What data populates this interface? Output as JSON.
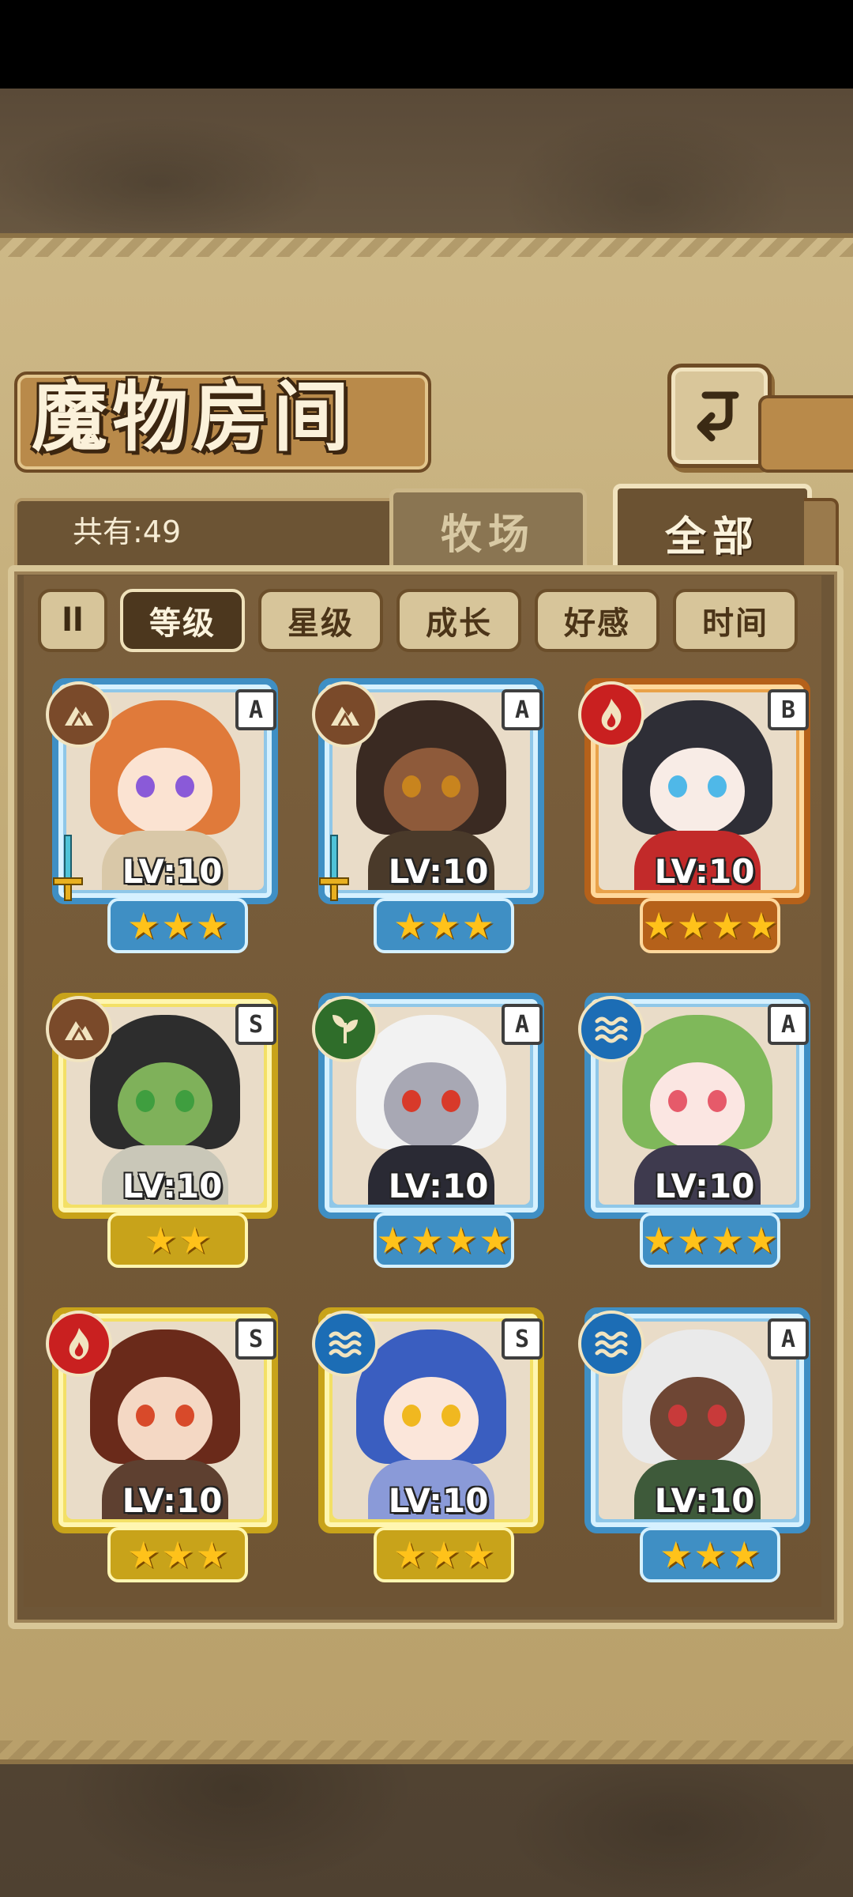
{
  "header": {
    "title": "魔物房间",
    "total_label": "共有:49"
  },
  "tabs": [
    {
      "label": "牧场",
      "active": false
    },
    {
      "label": "全部",
      "active": true
    }
  ],
  "filters": {
    "sort_toggle_label": "ll",
    "options": [
      {
        "label": "等级",
        "active": true
      },
      {
        "label": "星级",
        "active": false
      },
      {
        "label": "成长",
        "active": false
      },
      {
        "label": "好感",
        "active": false
      },
      {
        "label": "时间",
        "active": false
      }
    ]
  },
  "colors": {
    "rarity_A": "#3f8fc4",
    "rarity_B": "#b5611a",
    "rarity_S": "#c8a31a",
    "element_earth": "#7a4a2a",
    "element_fire": "#c92020",
    "element_water": "#1c6db5",
    "element_nature": "#2f6d2a"
  },
  "monsters": [
    {
      "rank": "A",
      "element": "earth-icon",
      "level": "LV:10",
      "stars": 3,
      "equipped": true,
      "hair": "#e07a3a",
      "eyes": "#8a5ad8",
      "skin": "#fbe3d2",
      "outfit": "#d9c8a8"
    },
    {
      "rank": "A",
      "element": "earth-icon",
      "level": "LV:10",
      "stars": 3,
      "equipped": true,
      "hair": "#3a2a22",
      "eyes": "#c8841e",
      "skin": "#8e5a3a",
      "outfit": "#4a3a2a"
    },
    {
      "rank": "B",
      "element": "fire-icon",
      "level": "LV:10",
      "stars": 4,
      "equipped": false,
      "hair": "#2e2e36",
      "eyes": "#4fb8e8",
      "skin": "#f8ece6",
      "outfit": "#c22a2a"
    },
    {
      "rank": "S",
      "element": "earth-icon",
      "level": "LV:10",
      "stars": 2,
      "equipped": false,
      "hair": "#2d2d2d",
      "eyes": "#3f9e3f",
      "skin": "#7fb15a",
      "outfit": "#c9c7b8"
    },
    {
      "rank": "A",
      "element": "nature-icon",
      "level": "LV:10",
      "stars": 4,
      "equipped": false,
      "hair": "#f2f2f2",
      "eyes": "#d83a2a",
      "skin": "#a8a8b4",
      "outfit": "#2a2a34"
    },
    {
      "rank": "A",
      "element": "water-icon",
      "level": "LV:10",
      "stars": 4,
      "equipped": false,
      "hair": "#7fb85a",
      "eyes": "#e65a6a",
      "skin": "#fbe6e2",
      "outfit": "#3e3a4e"
    },
    {
      "rank": "S",
      "element": "fire-icon",
      "level": "LV:10",
      "stars": 3,
      "equipped": false,
      "hair": "#6a2a1a",
      "eyes": "#d84a2a",
      "skin": "#f4d8c4",
      "outfit": "#5e4030"
    },
    {
      "rank": "S",
      "element": "water-icon",
      "level": "LV:10",
      "stars": 3,
      "equipped": false,
      "hair": "#3a5ec0",
      "eyes": "#f0b820",
      "skin": "#fbe6da",
      "outfit": "#8a9ad8"
    },
    {
      "rank": "A",
      "element": "water-icon",
      "level": "LV:10",
      "stars": 3,
      "equipped": false,
      "hair": "#eaeaea",
      "eyes": "#c83a3a",
      "skin": "#6e4634",
      "outfit": "#3e5a3a"
    }
  ]
}
